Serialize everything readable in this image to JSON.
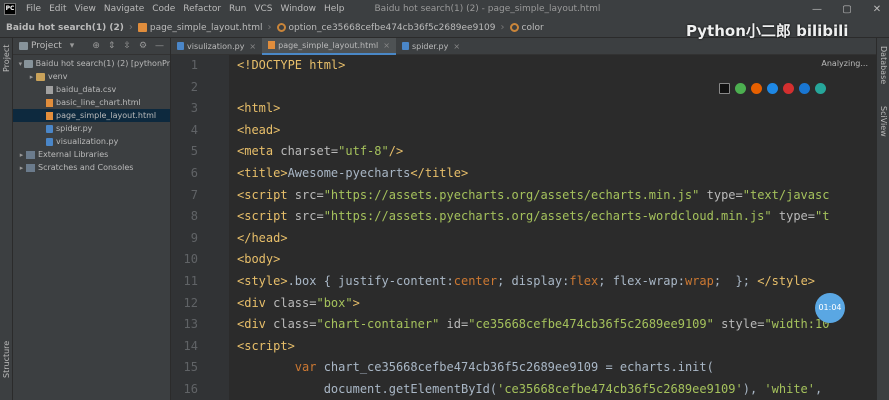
{
  "menubar": {
    "items": [
      "File",
      "Edit",
      "View",
      "Navigate",
      "Code",
      "Refactor",
      "Run",
      "VCS",
      "Window",
      "Help"
    ],
    "window_title": "Baidu hot search(1) (2) - page_simple_layout.html"
  },
  "navbar": {
    "crumbs": [
      "Baidu hot search(1) (2)",
      "page_simple_layout.html",
      "option_ce35668cefbe474cb36f5c2689ee9109",
      "color"
    ]
  },
  "stripes": {
    "left_top": "Project",
    "left_bottom": "Structure",
    "right_top": "Database",
    "right_mid": "SciView"
  },
  "project": {
    "title": "Project",
    "tree": [
      {
        "label": "Baidu hot search(1) (2) [pythonPr",
        "indent": 0,
        "arrow": "▾",
        "icon": "folder",
        "selected": false
      },
      {
        "label": "venv",
        "indent": 1,
        "arrow": "▸",
        "icon": "folder-y",
        "selected": false
      },
      {
        "label": "baidu_data.csv",
        "indent": 2,
        "arrow": "",
        "icon": "file-csv",
        "selected": false
      },
      {
        "label": "basic_line_chart.html",
        "indent": 2,
        "arrow": "",
        "icon": "file-html",
        "selected": false
      },
      {
        "label": "page_simple_layout.html",
        "indent": 2,
        "arrow": "",
        "icon": "file-html",
        "selected": true
      },
      {
        "label": "spider.py",
        "indent": 2,
        "arrow": "",
        "icon": "file-py",
        "selected": false
      },
      {
        "label": "visualization.py",
        "indent": 2,
        "arrow": "",
        "icon": "file-py",
        "selected": false
      },
      {
        "label": "External Libraries",
        "indent": 0,
        "arrow": "▸",
        "icon": "lib",
        "selected": false
      },
      {
        "label": "Scratches and Consoles",
        "indent": 0,
        "arrow": "▸",
        "icon": "lib",
        "selected": false
      }
    ]
  },
  "tabs": [
    {
      "label": "visulization.py",
      "icon": "file-py",
      "active": false
    },
    {
      "label": "page_simple_layout.html",
      "icon": "file-html",
      "active": true
    },
    {
      "label": "spider.py",
      "icon": "file-py",
      "active": false
    }
  ],
  "editor": {
    "status": "Analyzing...",
    "timer": "01:04",
    "line_numbers": [
      "1",
      "2",
      "3",
      "4",
      "5",
      "6",
      "7",
      "8",
      "9",
      "10",
      "11",
      "12",
      "13",
      "14",
      "15",
      "16"
    ],
    "lines": [
      [
        {
          "t": "tag",
          "v": "<!DOCTYPE html>"
        }
      ],
      [],
      [
        {
          "t": "tag",
          "v": "<html>"
        }
      ],
      [
        {
          "t": "tag",
          "v": "<head>"
        }
      ],
      [
        {
          "t": "tag",
          "v": "<meta "
        },
        {
          "t": "attr",
          "v": "charset="
        },
        {
          "t": "str",
          "v": "\"utf-8\""
        },
        {
          "t": "tag",
          "v": "/>"
        }
      ],
      [
        {
          "t": "tag",
          "v": "<title>"
        },
        {
          "t": "txt",
          "v": "Awesome-pyecharts"
        },
        {
          "t": "tag",
          "v": "</title>"
        }
      ],
      [
        {
          "t": "tag",
          "v": "<script "
        },
        {
          "t": "attr",
          "v": "src="
        },
        {
          "t": "str",
          "v": "\"https://assets.pyecharts.org/assets/echarts.min.js\""
        },
        {
          "t": "attr",
          "v": " type="
        },
        {
          "t": "str",
          "v": "\"text/javasc"
        }
      ],
      [
        {
          "t": "tag",
          "v": "<script "
        },
        {
          "t": "attr",
          "v": "src="
        },
        {
          "t": "str",
          "v": "\"https://assets.pyecharts.org/assets/echarts-wordcloud.min.js\""
        },
        {
          "t": "attr",
          "v": " type="
        },
        {
          "t": "str",
          "v": "\"t"
        }
      ],
      [
        {
          "t": "tag",
          "v": "</head>"
        }
      ],
      [
        {
          "t": "tag",
          "v": "<body>"
        }
      ],
      [
        {
          "t": "tag",
          "v": "<style>"
        },
        {
          "t": "txt",
          "v": ".box { justify-content:"
        },
        {
          "t": "css-val",
          "v": "center"
        },
        {
          "t": "txt",
          "v": "; display:"
        },
        {
          "t": "css-val",
          "v": "flex"
        },
        {
          "t": "txt",
          "v": "; flex-wrap:"
        },
        {
          "t": "css-val",
          "v": "wrap"
        },
        {
          "t": "txt",
          "v": ";  }; "
        },
        {
          "t": "tag",
          "v": "</style>"
        }
      ],
      [
        {
          "t": "tag",
          "v": "<div "
        },
        {
          "t": "attr",
          "v": "class="
        },
        {
          "t": "str",
          "v": "\"box\""
        },
        {
          "t": "tag",
          "v": ">"
        }
      ],
      [
        {
          "t": "tag",
          "v": "<div "
        },
        {
          "t": "attr",
          "v": "class="
        },
        {
          "t": "str",
          "v": "\"chart-container\""
        },
        {
          "t": "attr",
          "v": " id="
        },
        {
          "t": "str",
          "v": "\"ce35668cefbe474cb36f5c2689ee9109\""
        },
        {
          "t": "attr",
          "v": " style="
        },
        {
          "t": "str",
          "v": "\"width:10"
        }
      ],
      [
        {
          "t": "tag",
          "v": "<script>"
        }
      ],
      [
        {
          "t": "txt",
          "v": "        "
        },
        {
          "t": "kw",
          "v": "var"
        },
        {
          "t": "txt",
          "v": " chart_ce35668cefbe474cb36f5c2689ee9109 = echarts.init("
        }
      ],
      [
        {
          "t": "txt",
          "v": "            document.getElementById("
        },
        {
          "t": "str",
          "v": "'ce35668cefbe474cb36f5c2689ee9109'"
        },
        {
          "t": "txt",
          "v": "), "
        },
        {
          "t": "str",
          "v": "'white'"
        },
        {
          "t": "txt",
          "v": ","
        }
      ]
    ]
  },
  "watermark": "Python小二郎 bilibili",
  "colors": {
    "accent": "#4a88c7",
    "tag": "#e8bf6a",
    "string": "#a5c25c",
    "keyword": "#cc7832"
  }
}
